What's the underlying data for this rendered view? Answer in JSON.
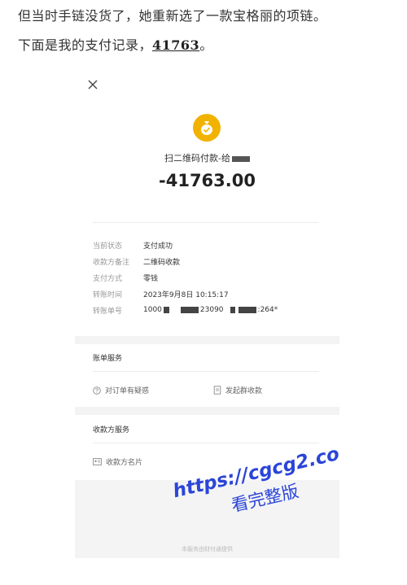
{
  "article": {
    "line1": "但当时手链没货了，她重新选了一款宝格丽的项链。",
    "line2_prefix": "下面是我的支付记录，",
    "line2_amount": "41763",
    "line2_suffix": "。"
  },
  "receipt": {
    "close_icon": "close-icon",
    "logo_icon": "money-bag-icon",
    "logo_color": "#f2b200",
    "title": "扫二维码付款-给",
    "amount": "-41763.00",
    "details": [
      {
        "key": "当前状态",
        "value": "支付成功"
      },
      {
        "key": "收款方备注",
        "value": "二维码收款"
      },
      {
        "key": "支付方式",
        "value": "零钱"
      },
      {
        "key": "转账时间",
        "value": "2023年9月8日 10:15:17"
      },
      {
        "key": "转账单号",
        "value_parts": [
          "1000",
          "23090",
          ":264*"
        ]
      }
    ],
    "billing_services": {
      "title": "账单服务",
      "actions": [
        {
          "label": "对订单有疑惑",
          "icon": "question-circle-icon"
        },
        {
          "label": "发起群收款",
          "icon": "group-receipt-icon"
        }
      ]
    },
    "payee_services": {
      "title": "收款方服务",
      "actions": [
        {
          "label": "收款方名片",
          "icon": "business-card-icon"
        }
      ]
    },
    "footer_note": "本服务由财付通提供"
  },
  "watermark": {
    "url": "https://cgcg2.co",
    "text": "看完整版",
    "color": "#2b45d8"
  }
}
